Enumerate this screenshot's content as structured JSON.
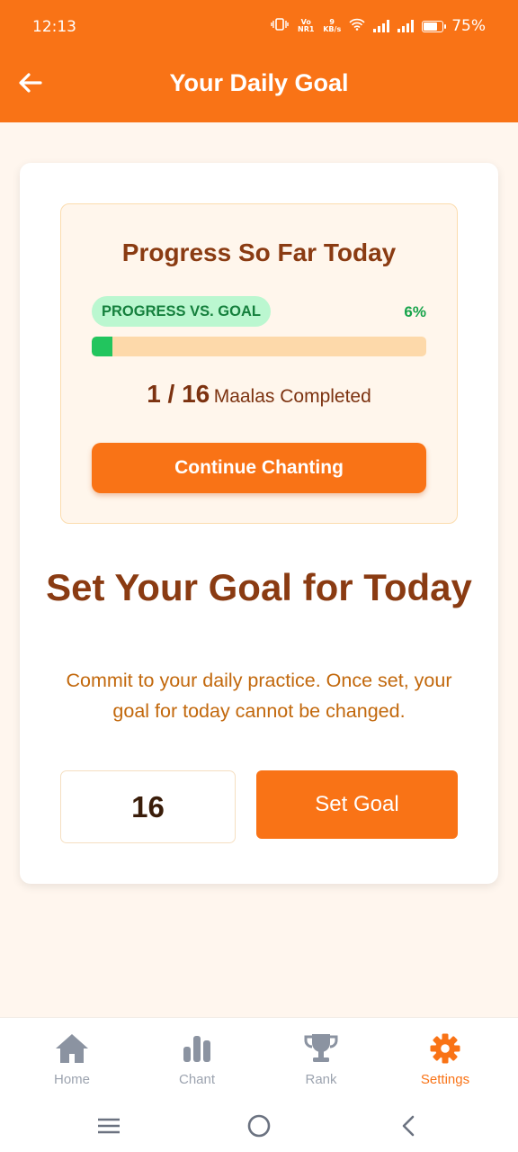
{
  "status_bar": {
    "time": "12:13",
    "network_badge": "Vo NR1",
    "data_speed_value": "9",
    "data_speed_unit": "KB/s",
    "battery_level": 75,
    "battery_percent": "75%"
  },
  "app_bar": {
    "title": "Your Daily Goal",
    "back_icon": "arrow-left-icon"
  },
  "progress_card": {
    "title": "Progress So Far Today",
    "badge": "PROGRESS VS. GOAL",
    "percent_label": "6%",
    "progress_fraction": 0.0625,
    "count": "1 / 16",
    "count_label": "Maalas Completed",
    "continue_button": "Continue Chanting"
  },
  "goal_section": {
    "heading": "Set Your Goal for Today",
    "description": "Commit to your daily practice. Once set, your goal for today cannot be changed.",
    "input_value": "16",
    "set_button": "Set Goal"
  },
  "bottom_nav": {
    "items": [
      {
        "label": "Home",
        "icon": "home-icon",
        "active": false
      },
      {
        "label": "Chant",
        "icon": "chart-bars-icon",
        "active": false
      },
      {
        "label": "Rank",
        "icon": "trophy-icon",
        "active": false
      },
      {
        "label": "Settings",
        "icon": "gear-icon",
        "active": true
      }
    ]
  },
  "system_nav": {
    "icons": [
      "menu-icon",
      "home-circle-icon",
      "back-chevron-icon"
    ]
  },
  "colors": {
    "brand_orange": "#f97316",
    "heading_brown": "#8a3b12",
    "success_green": "#22c55e",
    "inactive_gray": "#9ca3af",
    "page_bg": "#fff6ee"
  }
}
